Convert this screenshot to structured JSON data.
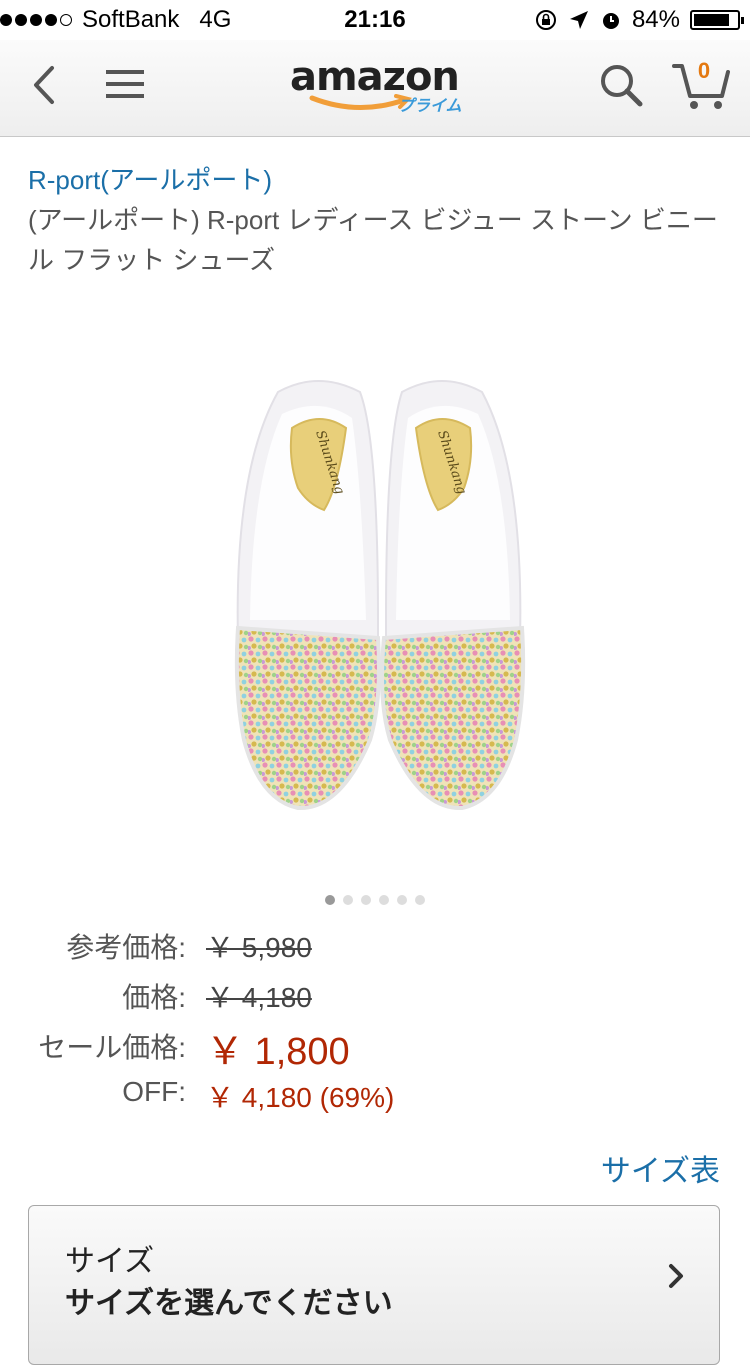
{
  "status_bar": {
    "carrier": "SoftBank",
    "network": "4G",
    "time": "21:16",
    "battery": "84%",
    "battery_level": 0.84,
    "signal_bars": 4,
    "signal_total": 5
  },
  "nav": {
    "logo_text": "amazon",
    "logo_sub": "プライム",
    "cart_count": "0"
  },
  "product": {
    "brand": "R-port(アールポート)",
    "title": "(アールポート) R-port レディース ビジュー ストーン ビニール フラット シューズ",
    "insole_text": "Shunkang",
    "image_index": 1,
    "image_count": 6
  },
  "prices": {
    "reference_label": "参考価格:",
    "reference_value": "￥ 5,980",
    "price_label": "価格:",
    "price_value": "￥ 4,180",
    "sale_label": "セール価格:",
    "sale_value": "￥ 1,800",
    "off_label": "OFF:",
    "off_value": "￥ 4,180 (69%)"
  },
  "size_chart_link": "サイズ表",
  "size_selector": {
    "label": "サイズ",
    "value": "サイズを選んでください"
  },
  "colors": {
    "link": "#1b6fa8",
    "price_red": "#b12704",
    "cart_orange": "#e47911",
    "prime_blue": "#3a9ad9"
  }
}
